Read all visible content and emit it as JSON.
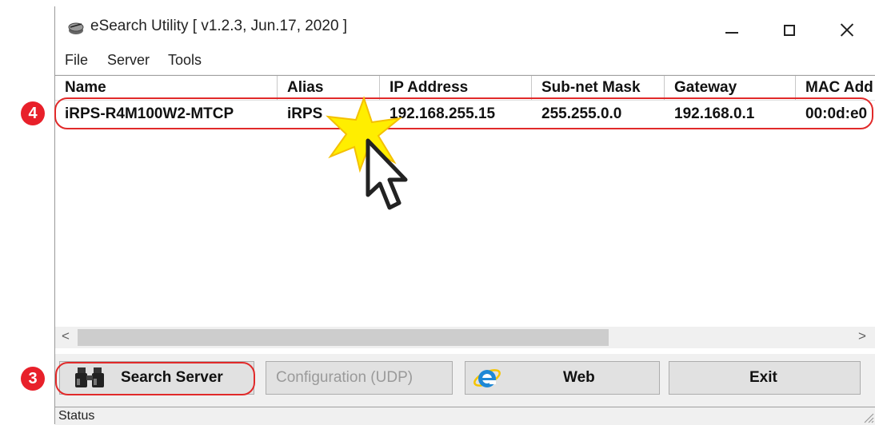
{
  "window": {
    "title": "eSearch Utility [ v1.2.3, Jun.17, 2020 ]"
  },
  "menu": [
    "File",
    "Server",
    "Tools"
  ],
  "table": {
    "columns": [
      "Name",
      "Alias",
      "IP Address",
      "Sub-net Mask",
      "Gateway",
      "MAC Add"
    ],
    "rows": [
      [
        "iRPS-R4M100W2-MTCP",
        "iRPS",
        "192.168.255.15",
        "255.255.0.0",
        "192.168.0.1",
        "00:0d:e0"
      ]
    ]
  },
  "scrollbar": {
    "left_arrow": "<",
    "right_arrow": ">"
  },
  "buttons": {
    "search": "Search Server",
    "config": "Configuration (UDP)",
    "web": "Web",
    "exit": "Exit"
  },
  "status": "Status",
  "markers": {
    "search_step": "3",
    "row_step": "4"
  },
  "colors": {
    "highlight": "#e12a2a",
    "marker": "#e8202a",
    "starburst": "#ffee00"
  }
}
